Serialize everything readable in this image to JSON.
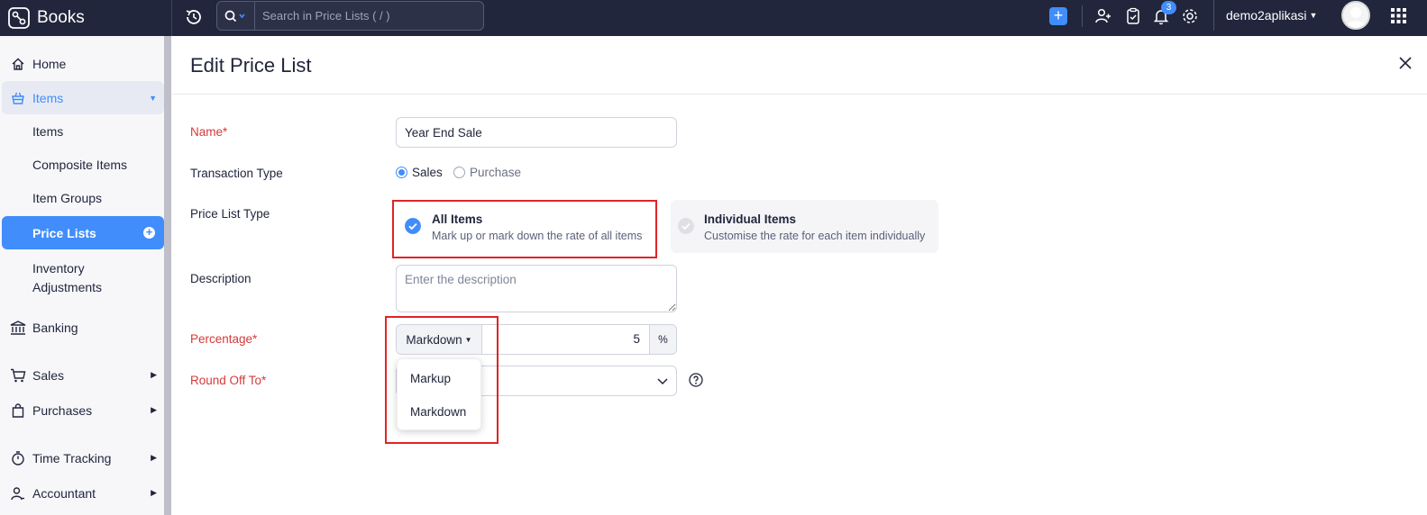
{
  "app": {
    "name": "Books"
  },
  "search": {
    "placeholder": "Search in Price Lists ( / )"
  },
  "topbar": {
    "notification_count": "3",
    "org_name": "demo2aplikasi"
  },
  "sidebar": {
    "home": "Home",
    "items_section": "Items",
    "sub_items": "Items",
    "composite_items": "Composite Items",
    "item_groups": "Item Groups",
    "price_lists": "Price Lists",
    "inventory_adjustments_1": "Inventory",
    "inventory_adjustments_2": "Adjustments",
    "banking": "Banking",
    "sales": "Sales",
    "purchases": "Purchases",
    "time_tracking": "Time Tracking",
    "accountant": "Accountant"
  },
  "page": {
    "title": "Edit Price List"
  },
  "form": {
    "name_label": "Name*",
    "name_value": "Year End Sale",
    "transaction_type_label": "Transaction Type",
    "transaction_options": [
      "Sales",
      "Purchase"
    ],
    "transaction_selected": "Sales",
    "price_list_type_label": "Price List Type",
    "all_items_title": "All Items",
    "all_items_desc": "Mark up or mark down the rate of all items",
    "individual_items_title": "Individual Items",
    "individual_items_desc": "Customise the rate for each item individually",
    "description_label": "Description",
    "description_placeholder": "Enter the description",
    "percentage_label": "Percentage*",
    "percentage_mode": "Markdown",
    "percentage_value": "5",
    "percentage_symbol": "%",
    "round_off_label": "Round Off To*",
    "dropdown_options": [
      "Markup",
      "Markdown"
    ]
  },
  "colors": {
    "accent": "#408dfb",
    "topbar": "#21263c",
    "required": "#d6393a",
    "highlight": "#e02424"
  }
}
